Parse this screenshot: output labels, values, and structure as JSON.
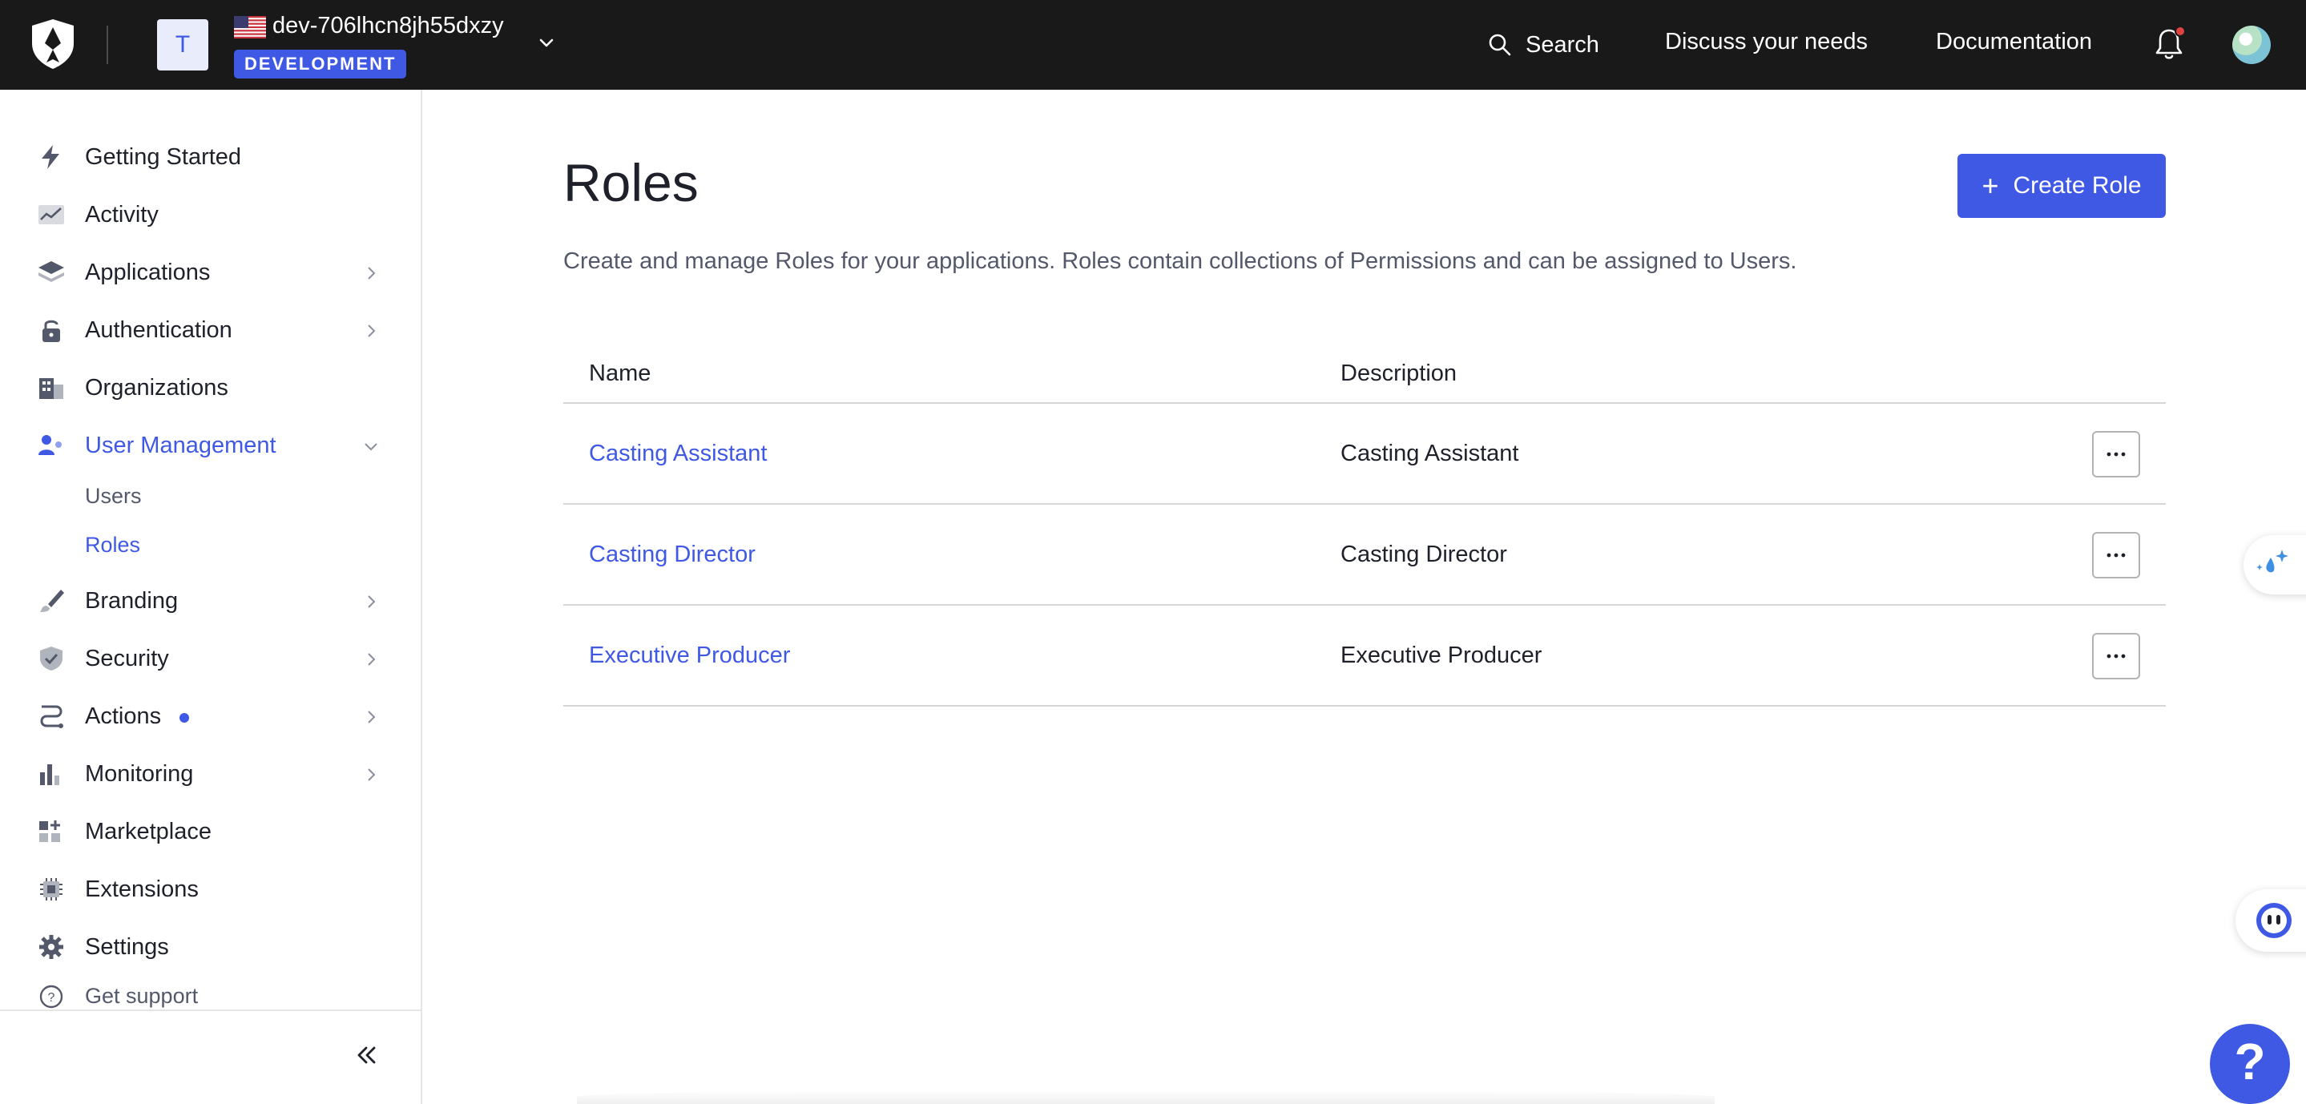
{
  "header": {
    "tenant_initial": "T",
    "tenant_name": "dev-706lhcn8jh55dxzy",
    "env_badge": "DEVELOPMENT",
    "search_label": "Search",
    "discuss_label": "Discuss your needs",
    "documentation_label": "Documentation"
  },
  "sidebar": {
    "items": [
      {
        "label": "Getting Started",
        "icon": "lightning-icon"
      },
      {
        "label": "Activity",
        "icon": "activity-chart-icon"
      },
      {
        "label": "Applications",
        "icon": "layers-icon"
      },
      {
        "label": "Authentication",
        "icon": "lock-icon"
      },
      {
        "label": "Organizations",
        "icon": "building-icon"
      },
      {
        "label": "User Management",
        "icon": "users-icon"
      },
      {
        "label": "Branding",
        "icon": "brush-icon"
      },
      {
        "label": "Security",
        "icon": "shield-check-icon"
      },
      {
        "label": "Actions",
        "icon": "flow-icon"
      },
      {
        "label": "Monitoring",
        "icon": "bar-chart-icon"
      },
      {
        "label": "Marketplace",
        "icon": "grid-plus-icon"
      },
      {
        "label": "Extensions",
        "icon": "chip-icon"
      },
      {
        "label": "Settings",
        "icon": "gear-icon"
      },
      {
        "label": "Get support",
        "icon": "question-circle-icon"
      }
    ],
    "user_management_sub": [
      {
        "label": "Users"
      },
      {
        "label": "Roles"
      }
    ]
  },
  "main": {
    "title": "Roles",
    "description": "Create and manage Roles for your applications. Roles contain collections of Permissions and can be assigned to Users.",
    "create_button": "Create Role",
    "table": {
      "columns": [
        "Name",
        "Description"
      ],
      "rows": [
        {
          "name": "Casting Assistant",
          "description": "Casting Assistant"
        },
        {
          "name": "Casting Director",
          "description": "Casting Director"
        },
        {
          "name": "Executive Producer",
          "description": "Executive Producer"
        }
      ]
    }
  },
  "help_button": "?",
  "colors": {
    "accent": "#3f59e4",
    "topbar": "#191919",
    "text": "#1e212a",
    "muted": "#53596a",
    "notification_dot": "#e04242"
  }
}
